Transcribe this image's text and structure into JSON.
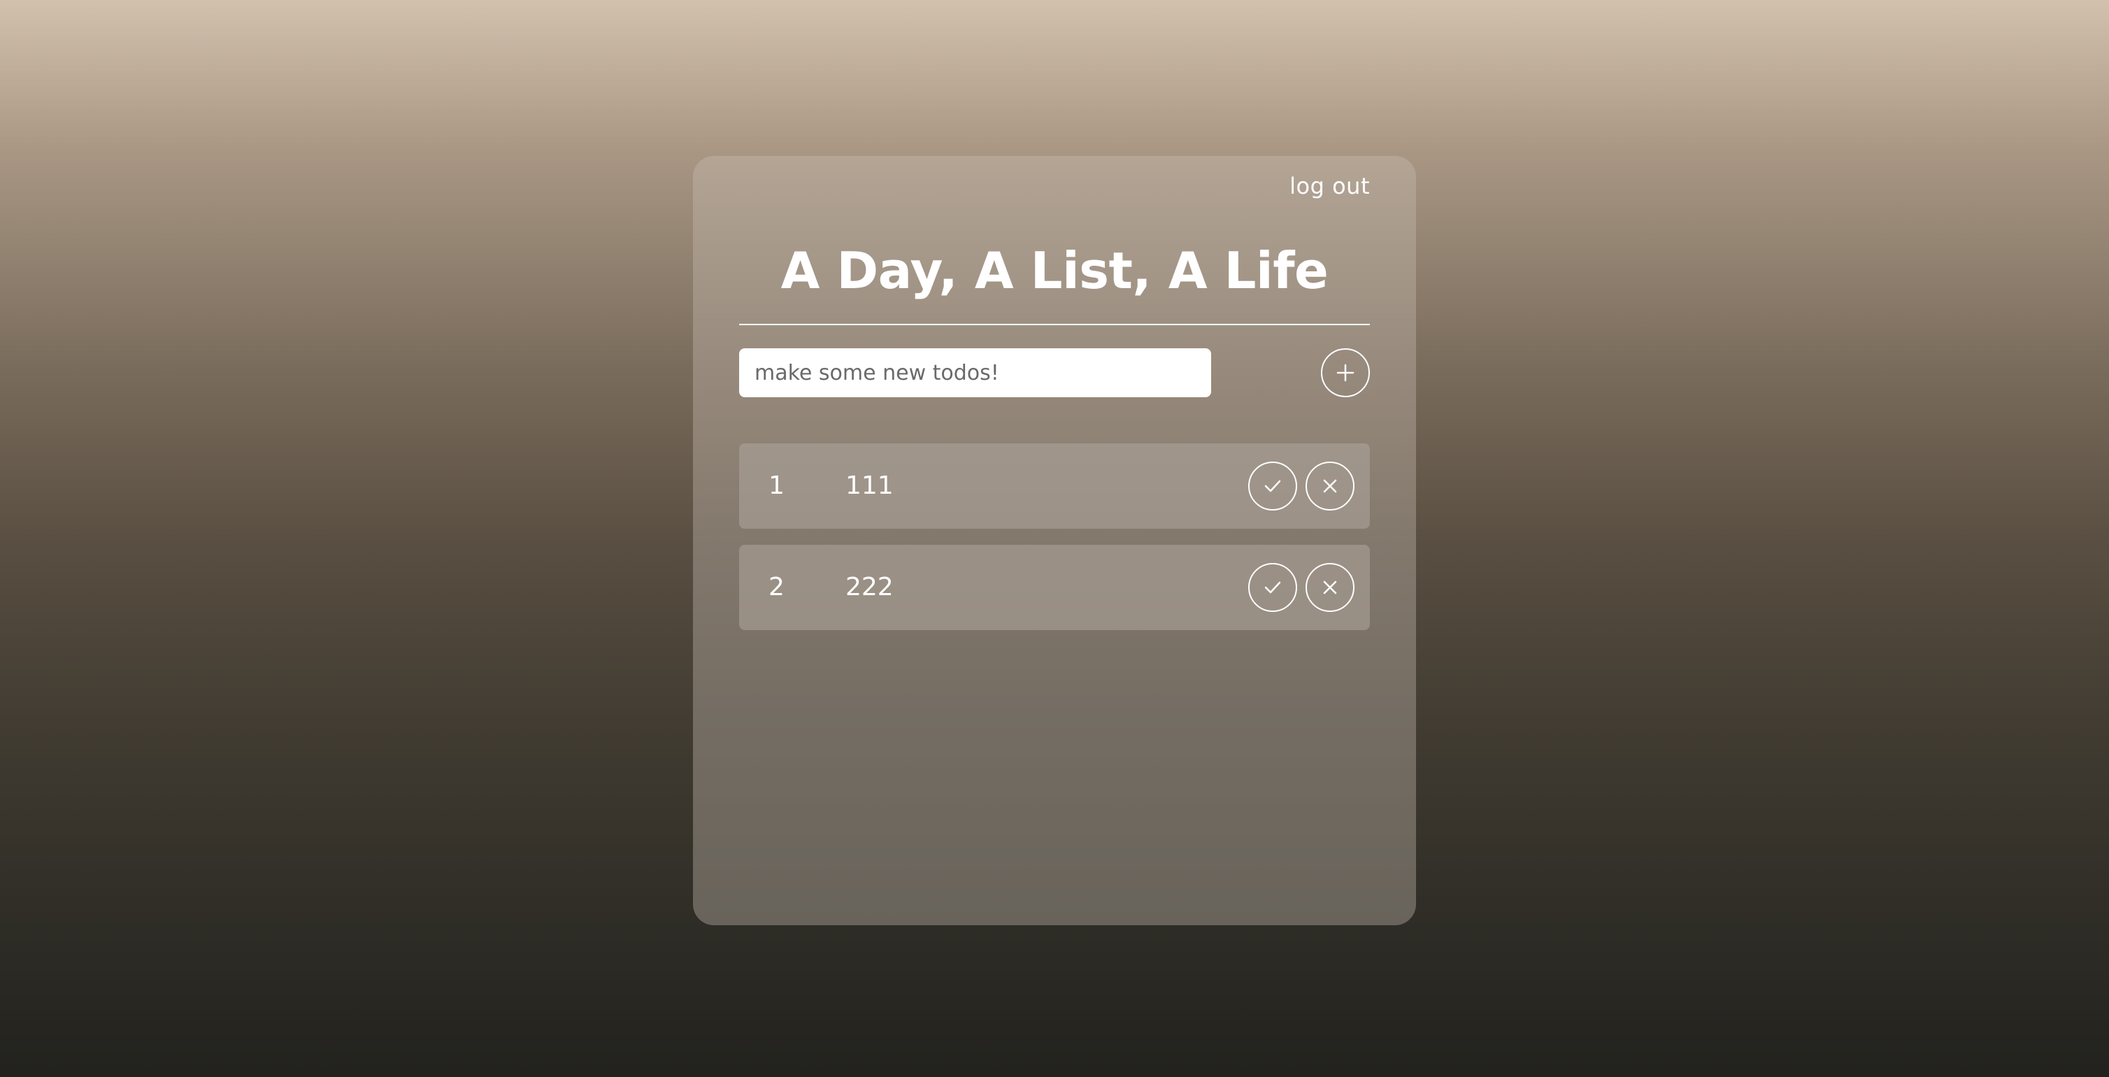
{
  "header": {
    "logout_label": "log out"
  },
  "main": {
    "title": "A Day, A List, A Life",
    "new_todo": {
      "placeholder": "make some new todos!",
      "value": ""
    },
    "add_icon": "plus-icon"
  },
  "todos": [
    {
      "index": "1",
      "text": "111",
      "done_icon": "check-icon",
      "delete_icon": "close-icon"
    },
    {
      "index": "2",
      "text": "222",
      "done_icon": "check-icon",
      "delete_icon": "close-icon"
    }
  ],
  "colors": {
    "background_top": "#d2c1ad",
    "background_bottom": "#22221e",
    "text": "#ffffff",
    "input_background": "#ffffff"
  }
}
